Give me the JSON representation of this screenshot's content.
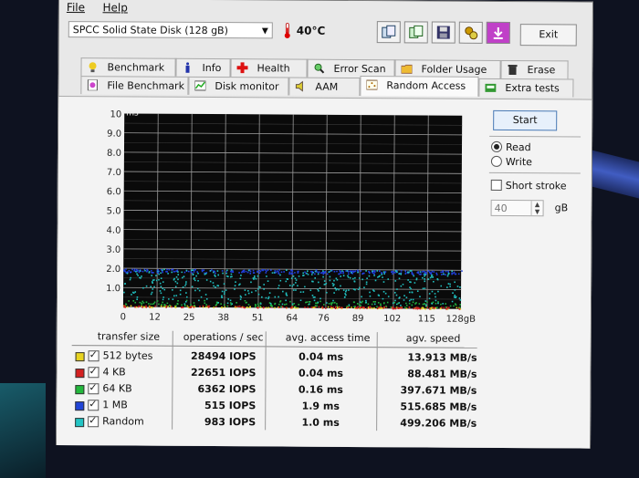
{
  "menu": {
    "file": "File",
    "help": "Help"
  },
  "drive": {
    "name": "SPCC Solid State Disk (128 gB)"
  },
  "temperature": "40°C",
  "toolbar_icons": [
    "copy-info-icon",
    "copy-screenshot-icon",
    "save-icon",
    "options-icon",
    "download-icon"
  ],
  "exit_label": "Exit",
  "tabs_row1": [
    {
      "label": "Benchmark",
      "icon": "benchmark-icon"
    },
    {
      "label": "Info",
      "icon": "info-icon"
    },
    {
      "label": "Health",
      "icon": "health-icon"
    },
    {
      "label": "Error Scan",
      "icon": "error-scan-icon"
    },
    {
      "label": "Folder Usage",
      "icon": "folder-usage-icon"
    },
    {
      "label": "Erase",
      "icon": "erase-icon"
    }
  ],
  "tabs_row2": [
    {
      "label": "File Benchmark",
      "icon": "file-benchmark-icon"
    },
    {
      "label": "Disk monitor",
      "icon": "disk-monitor-icon"
    },
    {
      "label": "AAM",
      "icon": "aam-icon"
    },
    {
      "label": "Random Access",
      "icon": "random-access-icon",
      "active": true
    },
    {
      "label": "Extra tests",
      "icon": "extra-tests-icon"
    }
  ],
  "controls": {
    "start_label": "Start",
    "read_label": "Read",
    "write_label": "Write",
    "mode": "read",
    "short_stroke_label": "Short stroke",
    "short_stroke_checked": false,
    "stroke_value": "40",
    "stroke_unit": "gB"
  },
  "chart_data": {
    "type": "scatter",
    "ylabel": "ms",
    "xlabel": "",
    "ylim": [
      0,
      10
    ],
    "xlim": [
      0,
      128
    ],
    "y_ticks": [
      "1.0",
      "2.0",
      "3.0",
      "4.0",
      "5.0",
      "6.0",
      "7.0",
      "8.0",
      "9.0",
      "10"
    ],
    "x_ticks": [
      "0",
      "12",
      "25",
      "38",
      "51",
      "64",
      "76",
      "89",
      "102",
      "115",
      "128gB"
    ],
    "grid": true,
    "series": [
      {
        "name": "512 bytes",
        "color": "#e0d020",
        "y_range": [
          0.02,
          0.1
        ]
      },
      {
        "name": "4 KB",
        "color": "#d02020",
        "y_range": [
          0.02,
          0.12
        ]
      },
      {
        "name": "64 KB",
        "color": "#20b040",
        "y_range": [
          0.1,
          0.4
        ]
      },
      {
        "name": "1 MB",
        "color": "#2040e0",
        "y_range": [
          1.8,
          2.0
        ]
      },
      {
        "name": "Random",
        "color": "#20c0c0",
        "y_range": [
          0.2,
          2.0
        ]
      }
    ]
  },
  "results": {
    "headers": {
      "transfer_size": "transfer size",
      "ops": "operations / sec",
      "access": "avg. access time",
      "speed": "agv. speed"
    },
    "rows": [
      {
        "name": "512 bytes",
        "color": "#e8d420",
        "checked": true,
        "ops": "28494 IOPS",
        "access": "0.04 ms",
        "speed": "13.913 MB/s"
      },
      {
        "name": "4 KB",
        "color": "#d42020",
        "checked": true,
        "ops": "22651 IOPS",
        "access": "0.04 ms",
        "speed": "88.481 MB/s"
      },
      {
        "name": "64 KB",
        "color": "#22b83c",
        "checked": true,
        "ops": "6362 IOPS",
        "access": "0.16 ms",
        "speed": "397.671 MB/s"
      },
      {
        "name": "1 MB",
        "color": "#2044d8",
        "checked": true,
        "ops": "515 IOPS",
        "access": "1.9 ms",
        "speed": "515.685 MB/s"
      },
      {
        "name": "Random",
        "color": "#22c4c4",
        "checked": true,
        "ops": "983 IOPS",
        "access": "1.0 ms",
        "speed": "499.206 MB/s"
      }
    ]
  }
}
